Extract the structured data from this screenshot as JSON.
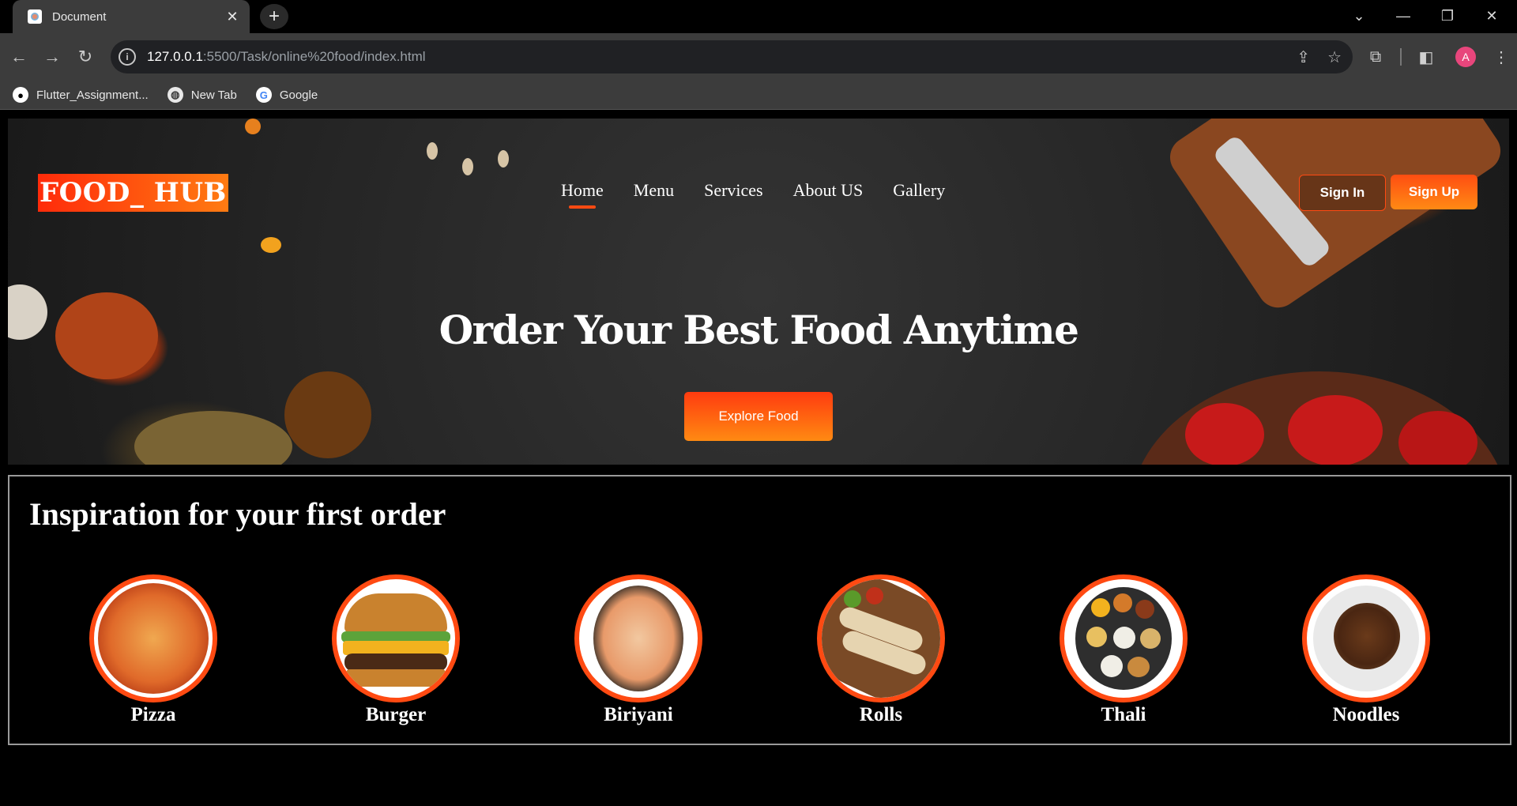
{
  "browser": {
    "tab_title": "Document",
    "url_host": "127.0.0.1",
    "url_path": ":5500/Task/online%20food/index.html",
    "profile_initial": "A",
    "bookmarks": [
      "Flutter_Assignment...",
      "New Tab",
      "Google"
    ]
  },
  "site": {
    "brand": "FOOD_ HUB",
    "nav": [
      "Home",
      "Menu",
      "Services",
      "About US",
      "Gallery"
    ],
    "sign_in": "Sign In",
    "sign_up": "Sign Up",
    "hero_title": "Order Your Best Food Anytime",
    "explore_button": "Explore Food",
    "inspiration_title": "Inspiration for your first order",
    "categories": [
      "Pizza",
      "Burger",
      "Biriyani",
      "Rolls",
      "Thali",
      "Noodles"
    ]
  },
  "colors": {
    "accent": "#ff4a12",
    "accent_gradient_end": "#ff8a12",
    "page_bg": "#000000",
    "chrome_bg": "#3c3c3c"
  }
}
